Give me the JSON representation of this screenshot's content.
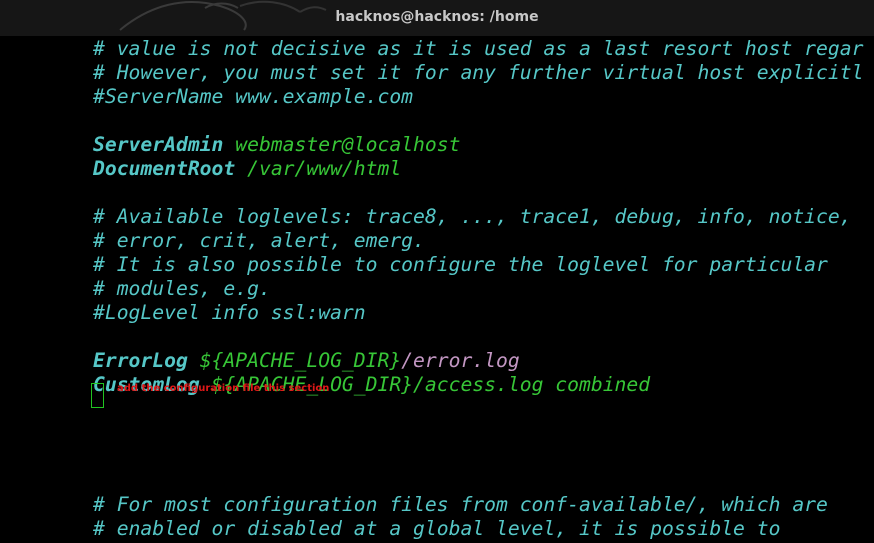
{
  "window": {
    "title": "hacknos@hacknos: /home"
  },
  "editor": {
    "lines": {
      "l1": "# value is not decisive as it is used as a last resort host regar",
      "l2": "# However, you must set it for any further virtual host explicitl",
      "l3": "#ServerName www.example.com",
      "server_admin_key": "ServerAdmin",
      "server_admin_value": "webmaster@localhost",
      "document_root_key": "DocumentRoot",
      "document_root_value": "/var/www/html",
      "l8": "# Available loglevels: trace8, ..., trace1, debug, info, notice,",
      "l9": "# error, crit, alert, emerg.",
      "l10": "# It is also possible to configure the loglevel for particular",
      "l11": "# modules, e.g.",
      "l12": "#LogLevel info ssl:warn",
      "error_log_key": "ErrorLog",
      "error_log_var": "${APACHE_LOG_DIR}",
      "error_log_file": "/error.log",
      "custom_log_key": "CustomLog",
      "custom_log_value": "${APACHE_LOG_DIR}/access.log combined",
      "l19": "# For most configuration files from conf-available/, which are",
      "l20": "# enabled or disabled at a global level, it is possible to"
    },
    "annotation": "add the configuration file this section"
  },
  "colors": {
    "comment": "#56c7c7",
    "value": "#37c637",
    "path": "#c397c3",
    "annotation": "#e01818",
    "cursor": "#21c521",
    "background": "#000000"
  }
}
